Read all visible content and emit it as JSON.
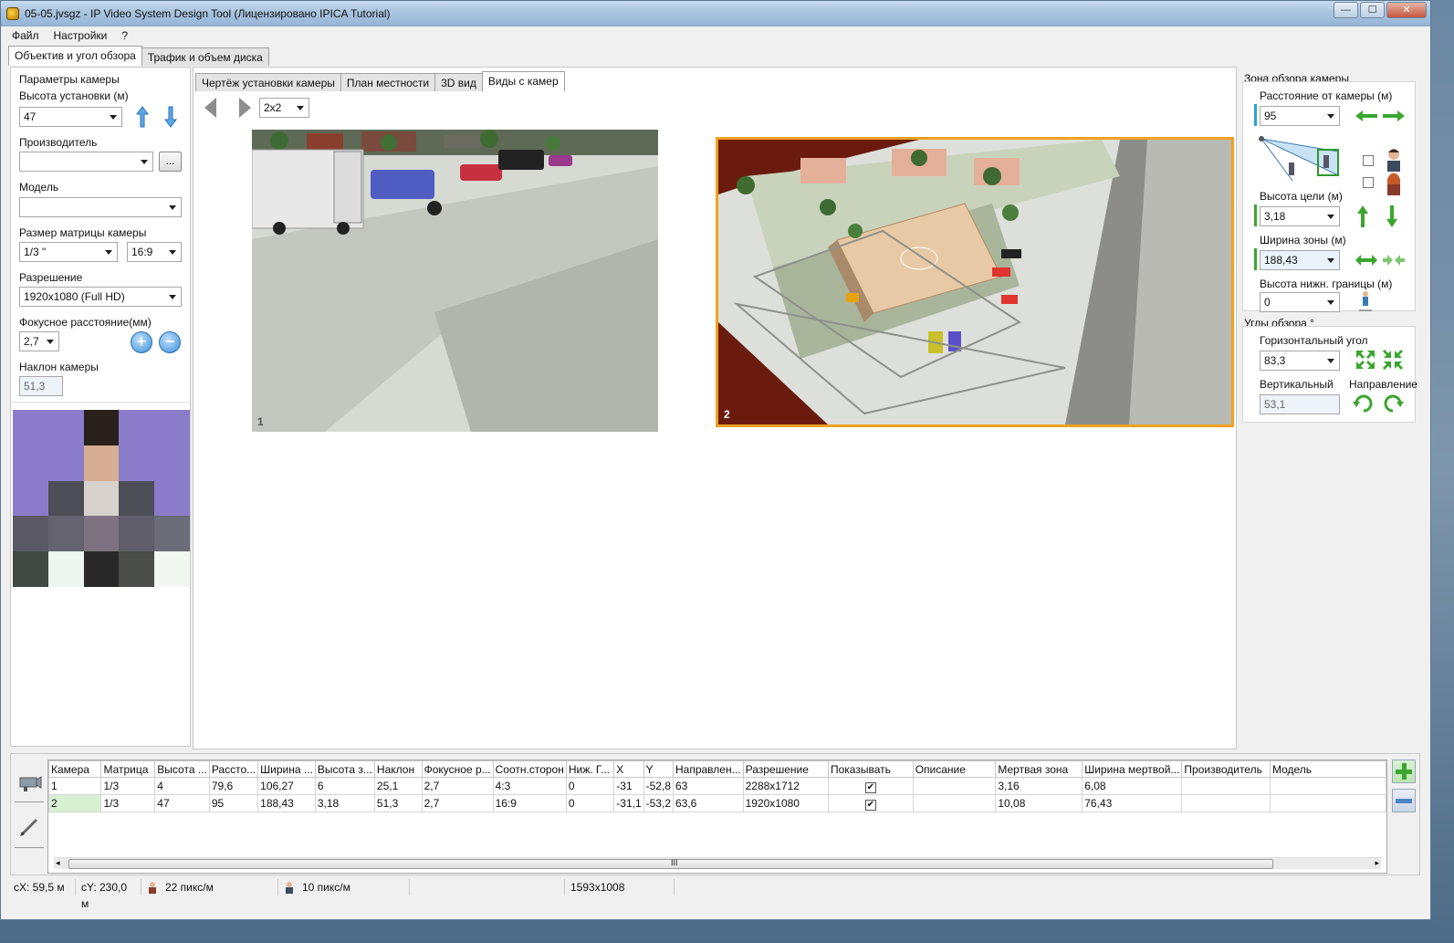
{
  "window": {
    "title": "05-05.jvsgz - IP Video System Design Tool (Лицензировано  IPICA Tutorial)",
    "min": "—",
    "max": "☐",
    "close": "✕"
  },
  "menu": [
    "Файл",
    "Настройки",
    "?"
  ],
  "main_tabs": [
    "Объектив и угол обзора",
    "Трафик и объем диска"
  ],
  "left": {
    "group_title": "Параметры камеры",
    "height_label": "Высота установки (м)",
    "height_value": "47",
    "manufacturer_label": "Производитель",
    "manufacturer_value": "",
    "browse_label": "...",
    "model_label": "Модель",
    "model_value": "",
    "matrix_label": "Размер матрицы камеры",
    "matrix_value": "1/3 \"",
    "aspect_value": "16:9",
    "resolution_label": "Разрешение",
    "resolution_value": "1920x1080 (Full HD)",
    "focal_label": "Фокусное расстояние(мм)",
    "focal_value": "2,7",
    "tilt_label": "Наклон камеры",
    "tilt_value": "51,3"
  },
  "center": {
    "tabs": [
      "Чертёж установки камеры",
      "План местности",
      "3D вид",
      "Виды с камер"
    ],
    "grid_value": "2x2",
    "view1_num": "1",
    "view2_num": "2"
  },
  "right": {
    "zone_title": "Зона обзора камеры",
    "distance_label": "Расстояние от камеры (м)",
    "distance_value": "95",
    "target_height_label": "Высота цели (м)",
    "target_height_value": "3,18",
    "zone_width_label": "Ширина зоны (м)",
    "zone_width_value": "188,43",
    "lower_bound_label": "Высота нижн. границы (м)",
    "lower_bound_value": "0",
    "angles_title": "Углы обзора °",
    "horizontal_label": "Горизонтальный угол",
    "horizontal_value": "83,3",
    "vertical_label": "Вертикальный",
    "vertical_value": "53,1",
    "direction_label": "Направление"
  },
  "table": {
    "columns": [
      "Камера",
      "Матрица",
      "Высота ...",
      "Рассто...",
      "Ширина ...",
      "Высота з...",
      "Наклон",
      "Фокусное р...",
      "Соотн.сторон",
      "Ниж. Г...",
      "X",
      "Y",
      "Направлен...",
      "Разрешение",
      "Показывать",
      "Описание",
      "Мертвая зона",
      "Ширина мертвой...",
      "Производитель",
      "Модель"
    ],
    "rows": [
      [
        "1",
        "1/3",
        "4",
        "79,6",
        "106,27",
        "6",
        "25,1",
        "2,7",
        "4:3",
        "0",
        "-31",
        "-52,8",
        "63",
        "2288x1712",
        "✔",
        "",
        "3,16",
        "6,08",
        "",
        ""
      ],
      [
        "2",
        "1/3",
        "47",
        "95",
        "188,43",
        "3,18",
        "51,3",
        "2,7",
        "16:9",
        "0",
        "-31,1",
        "-53,2",
        "63,6",
        "1920x1080",
        "✔",
        "",
        "10,08",
        "76,43",
        "",
        ""
      ]
    ],
    "scroll_grip": "III"
  },
  "status": {
    "cx": "cX: 59,5 м",
    "cy": "cY: 230,0 м",
    "pix1": "22 пикс/м",
    "pix2": "10 пикс/м",
    "size": "1593x1008"
  },
  "colors": {
    "accent_orange": "#f0a020",
    "green_arrow": "#3aa62f",
    "blue_arrow": "#3b8fd8"
  }
}
